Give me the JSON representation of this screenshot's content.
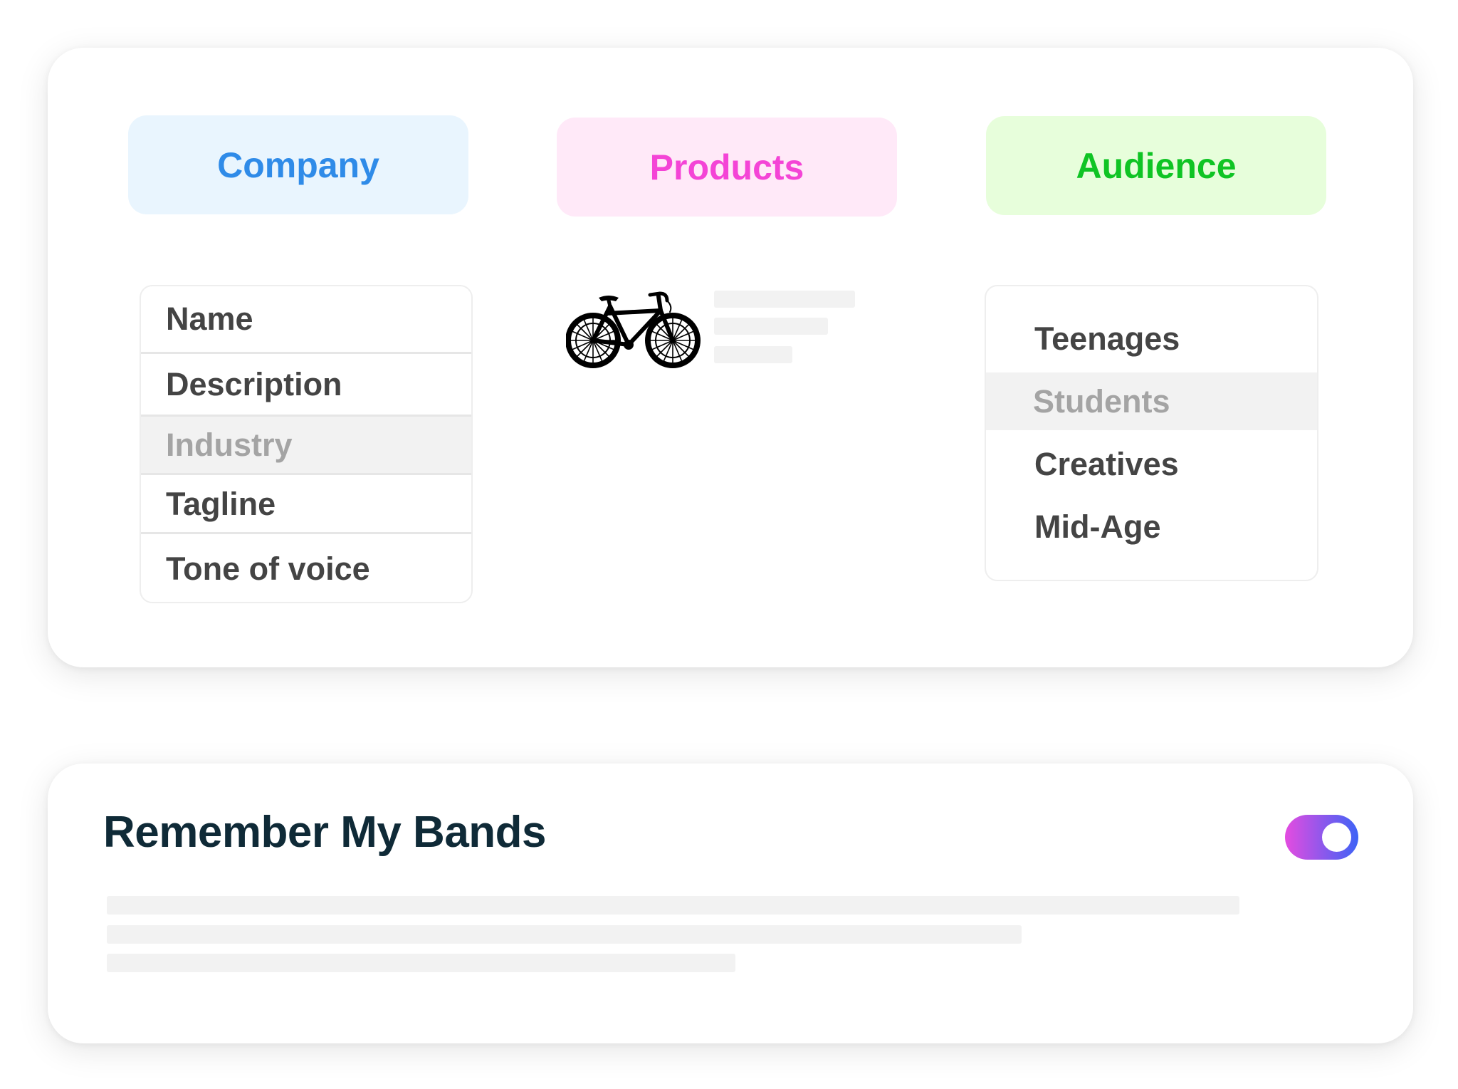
{
  "categories": {
    "company": {
      "label": "Company",
      "text_color": "#2f8be8",
      "bg_color": "#e9f5fe"
    },
    "products": {
      "label": "Products",
      "text_color": "#f444d6",
      "bg_color": "#ffe9f8"
    },
    "audience": {
      "label": "Audience",
      "text_color": "#0fc424",
      "bg_color": "#e7fedb"
    }
  },
  "company_fields": [
    "Name",
    "Description",
    "Industry",
    "Tagline",
    "Tone of voice"
  ],
  "company_selected": "Industry",
  "product": {
    "icon": "bicycle-icon"
  },
  "audience_options": [
    "Teenages",
    "Students",
    "Creatives",
    "Mid-Age"
  ],
  "audience_selected": "Students",
  "settings": {
    "title": "Remember My Bands",
    "toggle_on": true
  }
}
